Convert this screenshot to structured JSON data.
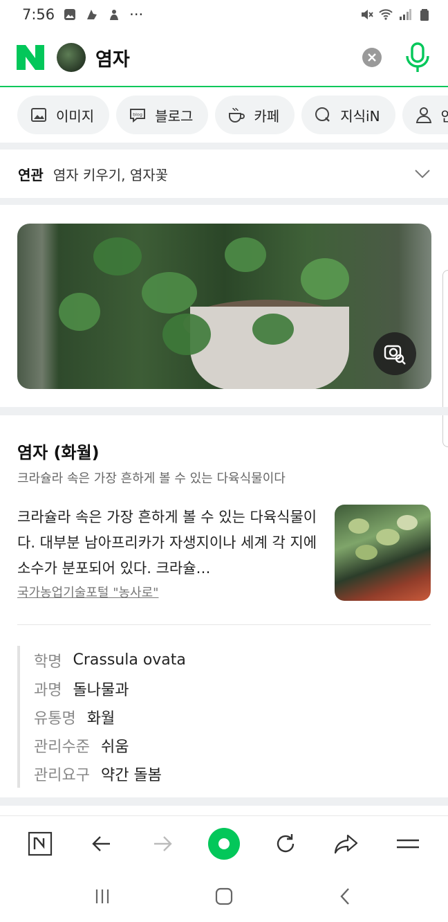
{
  "status": {
    "time": "7:56",
    "dots": "···"
  },
  "search": {
    "query": "염자"
  },
  "tabs": [
    {
      "label": "이미지",
      "icon": "image-icon"
    },
    {
      "label": "블로그",
      "icon": "blog-icon"
    },
    {
      "label": "카페",
      "icon": "cafe-icon"
    },
    {
      "label": "지식iN",
      "icon": "kin-icon"
    },
    {
      "label": "인",
      "icon": "person-icon"
    }
  ],
  "related": {
    "label": "연관",
    "text": "염자 키우기, 염자꽃"
  },
  "info": {
    "title": "염자 (화월)",
    "subtitle": "크라슐라 속은 가장 흔하게 볼 수 있는 다육식물이다",
    "description": "크라슐라 속은 가장 흔하게 볼 수 있는 다육식물이다. 대부분 남아프리카가 자생지이나 세계 각 지에 소수가 분포되어 있다. 크라슐…",
    "source": "국가농업기술포털 \"농사로\"",
    "facts": [
      {
        "key": "학명",
        "value": "Crassula ovata"
      },
      {
        "key": "과명",
        "value": "돌나물과"
      },
      {
        "key": "유통명",
        "value": "화월"
      },
      {
        "key": "관리수준",
        "value": "쉬움"
      },
      {
        "key": "관리요구",
        "value": "약간 돌봄"
      }
    ]
  },
  "colors": {
    "brand": "#03c75a"
  }
}
